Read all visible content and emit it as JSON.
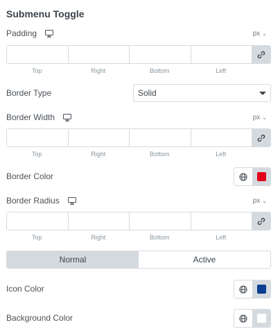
{
  "section": {
    "title": "Submenu Toggle"
  },
  "padding": {
    "label": "Padding",
    "unit": "px",
    "sides": [
      "Top",
      "Right",
      "Bottom",
      "Left"
    ]
  },
  "border_type": {
    "label": "Border Type",
    "value": "Solid"
  },
  "border_width": {
    "label": "Border Width",
    "unit": "px",
    "sides": [
      "Top",
      "Right",
      "Bottom",
      "Left"
    ]
  },
  "border_color": {
    "label": "Border Color",
    "swatch": "#e2001a"
  },
  "border_radius": {
    "label": "Border Radius",
    "unit": "px",
    "sides": [
      "Top",
      "Right",
      "Bottom",
      "Left"
    ]
  },
  "state_tabs": {
    "normal": "Normal",
    "active": "Active"
  },
  "icon_color": {
    "label": "Icon Color",
    "swatch": "#0b3d91"
  },
  "background_color": {
    "label": "Background Color",
    "swatch": "#ffffff"
  },
  "icons": {
    "monitor": "monitor-icon",
    "link": "link-icon",
    "globe": "globe-icon",
    "caret": "caret-down-icon",
    "chevron": "chevron-down-icon"
  }
}
